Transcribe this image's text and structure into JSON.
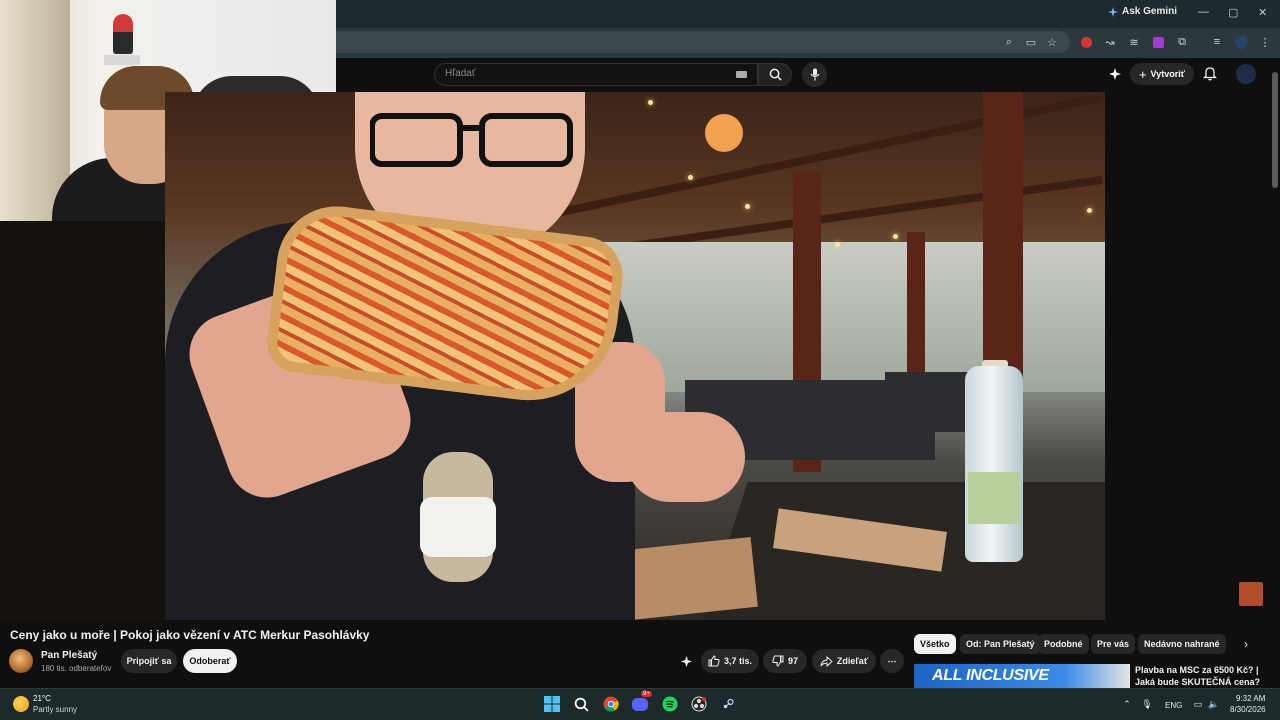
{
  "browser": {
    "ask_gemini_label": "Ask Gemini",
    "window_controls": [
      "—",
      "▢",
      "✕"
    ]
  },
  "youtube": {
    "search": {
      "placeholder": "Hľadať"
    },
    "create_label": "Vytvoriť"
  },
  "video": {
    "title": "Ceny jako u moře | Pokoj jako vězení v ATC Merkur Pasohlávky"
  },
  "channel": {
    "name": "Pan Plešatý",
    "subscribers": "180 tis. odberateľov",
    "join_label": "Pripojiť sa",
    "subscribe_label": "Odoberať"
  },
  "actions": {
    "likes": "3,7 tis.",
    "dislikes": "97",
    "share_label": "Zdieľať",
    "more_label": "⋯"
  },
  "chips": [
    {
      "label": "Všetko",
      "active": true
    },
    {
      "label": "Od: Pan Plešatý",
      "active": false
    },
    {
      "label": "Podobné",
      "active": false
    },
    {
      "label": "Pre vás",
      "active": false
    },
    {
      "label": "Nedávno nahrané",
      "active": false
    }
  ],
  "recommendation": {
    "thumb_text": "ALL INCLUSIVE",
    "title": "Plavba na MSC za 6500 Kč? | Jaká bude SKUTEČNÁ cena? |"
  },
  "taskbar": {
    "weather_temp": "21°C",
    "weather_desc": "Partly sunny",
    "language": "ENG",
    "time": "9:32 AM",
    "date": "8/30/2026",
    "discord_badge": "9+"
  },
  "colors": {
    "yt_bg": "#0f0f0f",
    "chrome_toolbar": "#2c383d",
    "taskbar": "#1c2a2c",
    "chip_active": "#f1f1f1"
  }
}
